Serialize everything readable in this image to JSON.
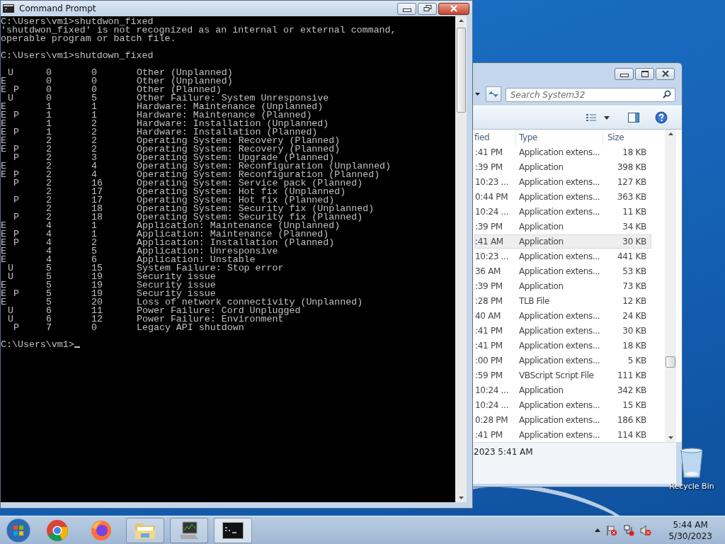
{
  "cmd_window": {
    "title": "Command Prompt",
    "output_lines": [
      "C:\\Users\\vm1>shutdwon_fixed",
      "'shutdwon_fixed' is not recognized as an internal or external command,",
      "operable program or batch file."
    ],
    "command_line": "C:\\Users\\vm1>shutdown_fixed",
    "rows": [
      {
        "type": "U",
        "major": "0",
        "minor": "0",
        "reason": "Other (Unplanned)"
      },
      {
        "expected": "E",
        "major": "0",
        "minor": "0",
        "reason": "Other (Unplanned)"
      },
      {
        "expected": "E",
        "type": "P",
        "major": "0",
        "minor": "0",
        "reason": "Other (Planned)"
      },
      {
        "type": "U",
        "major": "0",
        "minor": "5",
        "reason": "Other Failure: System Unresponsive"
      },
      {
        "expected": "E",
        "major": "1",
        "minor": "1",
        "reason": "Hardware: Maintenance (Unplanned)"
      },
      {
        "expected": "E",
        "type": "P",
        "major": "1",
        "minor": "1",
        "reason": "Hardware: Maintenance (Planned)"
      },
      {
        "expected": "E",
        "major": "1",
        "minor": "2",
        "reason": "Hardware: Installation (Unplanned)"
      },
      {
        "expected": "E",
        "type": "P",
        "major": "1",
        "minor": "2",
        "reason": "Hardware: Installation (Planned)"
      },
      {
        "expected": "E",
        "major": "2",
        "minor": "2",
        "reason": "Operating System: Recovery (Planned)"
      },
      {
        "expected": "E",
        "type": "P",
        "major": "2",
        "minor": "2",
        "reason": "Operating System: Recovery (Planned)"
      },
      {
        "type": "P",
        "major": "2",
        "minor": "3",
        "reason": "Operating System: Upgrade (Planned)"
      },
      {
        "expected": "E",
        "major": "2",
        "minor": "4",
        "reason": "Operating System: Reconfiguration (Unplanned)"
      },
      {
        "expected": "E",
        "type": "P",
        "major": "2",
        "minor": "4",
        "reason": "Operating System: Reconfiguration (Planned)"
      },
      {
        "type": "P",
        "major": "2",
        "minor": "16",
        "reason": "Operating System: Service pack (Planned)"
      },
      {
        "major": "2",
        "minor": "17",
        "reason": "Operating System: Hot fix (Unplanned)"
      },
      {
        "type": "P",
        "major": "2",
        "minor": "17",
        "reason": "Operating System: Hot fix (Planned)"
      },
      {
        "major": "2",
        "minor": "18",
        "reason": "Operating System: Security fix (Unplanned)"
      },
      {
        "type": "P",
        "major": "2",
        "minor": "18",
        "reason": "Operating System: Security fix (Planned)"
      },
      {
        "expected": "E",
        "major": "4",
        "minor": "1",
        "reason": "Application: Maintenance (Unplanned)"
      },
      {
        "expected": "E",
        "type": "P",
        "major": "4",
        "minor": "1",
        "reason": "Application: Maintenance (Planned)"
      },
      {
        "expected": "E",
        "type": "P",
        "major": "4",
        "minor": "2",
        "reason": "Application: Installation (Planned)"
      },
      {
        "expected": "E",
        "major": "4",
        "minor": "5",
        "reason": "Application: Unresponsive"
      },
      {
        "expected": "E",
        "major": "4",
        "minor": "6",
        "reason": "Application: Unstable"
      },
      {
        "type": "U",
        "major": "5",
        "minor": "15",
        "reason": "System Failure: Stop error"
      },
      {
        "type": "U",
        "major": "5",
        "minor": "19",
        "reason": "Security issue"
      },
      {
        "expected": "E",
        "major": "5",
        "minor": "19",
        "reason": "Security issue"
      },
      {
        "expected": "E",
        "type": "P",
        "major": "5",
        "minor": "19",
        "reason": "Security issue"
      },
      {
        "expected": "E",
        "major": "5",
        "minor": "20",
        "reason": "Loss of network connectivity (Unplanned)"
      },
      {
        "type": "U",
        "major": "6",
        "minor": "11",
        "reason": "Power Failure: Cord Unplugged"
      },
      {
        "type": "U",
        "major": "6",
        "minor": "12",
        "reason": "Power Failure: Environment"
      },
      {
        "type": "P",
        "major": "7",
        "minor": "0",
        "reason": "Legacy API shutdown"
      }
    ],
    "prompt": "C:\\Users\\vm1>"
  },
  "explorer_window": {
    "search": {
      "placeholder": "Search System32"
    },
    "columns": [
      "fied",
      "Type",
      "Size"
    ],
    "files": [
      {
        "modified": ":41 PM",
        "type": "Application extens...",
        "size": "18 KB",
        "selected": false
      },
      {
        "modified": ":39 PM",
        "type": "Application",
        "size": "398 KB",
        "selected": false
      },
      {
        "modified": "10:23 ...",
        "type": "Application extens...",
        "size": "127 KB",
        "selected": false
      },
      {
        "modified": "0:44 PM",
        "type": "Application extens...",
        "size": "363 KB",
        "selected": false
      },
      {
        "modified": "10:24 ...",
        "type": "Application extens...",
        "size": "11 KB",
        "selected": false
      },
      {
        "modified": ":39 PM",
        "type": "Application",
        "size": "34 KB",
        "selected": false
      },
      {
        "modified": ":41 AM",
        "type": "Application",
        "size": "30 KB",
        "selected": true
      },
      {
        "modified": "10:23 ...",
        "type": "Application extens...",
        "size": "441 KB",
        "selected": false
      },
      {
        "modified": "36 AM",
        "type": "Application extens...",
        "size": "53 KB",
        "selected": false
      },
      {
        "modified": ":39 PM",
        "type": "Application",
        "size": "73 KB",
        "selected": false
      },
      {
        "modified": ":28 PM",
        "type": "TLB File",
        "size": "12 KB",
        "selected": false
      },
      {
        "modified": "40 AM",
        "type": "Application extens...",
        "size": "24 KB",
        "selected": false
      },
      {
        "modified": ":41 PM",
        "type": "Application extens...",
        "size": "30 KB",
        "selected": false
      },
      {
        "modified": ":41 PM",
        "type": "Application extens...",
        "size": "18 KB",
        "selected": false
      },
      {
        "modified": ":00 PM",
        "type": "Application extens...",
        "size": "5 KB",
        "selected": false
      },
      {
        "modified": ":59 PM",
        "type": "VBScript Script File",
        "size": "111 KB",
        "selected": false
      },
      {
        "modified": "10:24 ...",
        "type": "Application",
        "size": "342 KB",
        "selected": false
      },
      {
        "modified": "10:24 ...",
        "type": "Application extens...",
        "size": "15 KB",
        "selected": false
      },
      {
        "modified": "0:28 PM",
        "type": "Application extens...",
        "size": "186 KB",
        "selected": false
      },
      {
        "modified": ":41 PM",
        "type": "Application extens...",
        "size": "114 KB",
        "selected": false
      }
    ],
    "details": "2023 5:41 AM"
  },
  "desktop_icons": [
    {
      "label": "Recycle Bin"
    }
  ],
  "taskbar": {
    "items": [
      {
        "kind": "chrome",
        "open": false,
        "active": false
      },
      {
        "kind": "firefox",
        "open": false,
        "active": false
      },
      {
        "kind": "folder",
        "open": true,
        "active": false
      },
      {
        "kind": "monitor",
        "open": true,
        "active": false
      },
      {
        "kind": "console",
        "open": true,
        "active": true
      }
    ],
    "clock": {
      "time": "5:44 AM",
      "date": "5/30/2023"
    }
  }
}
